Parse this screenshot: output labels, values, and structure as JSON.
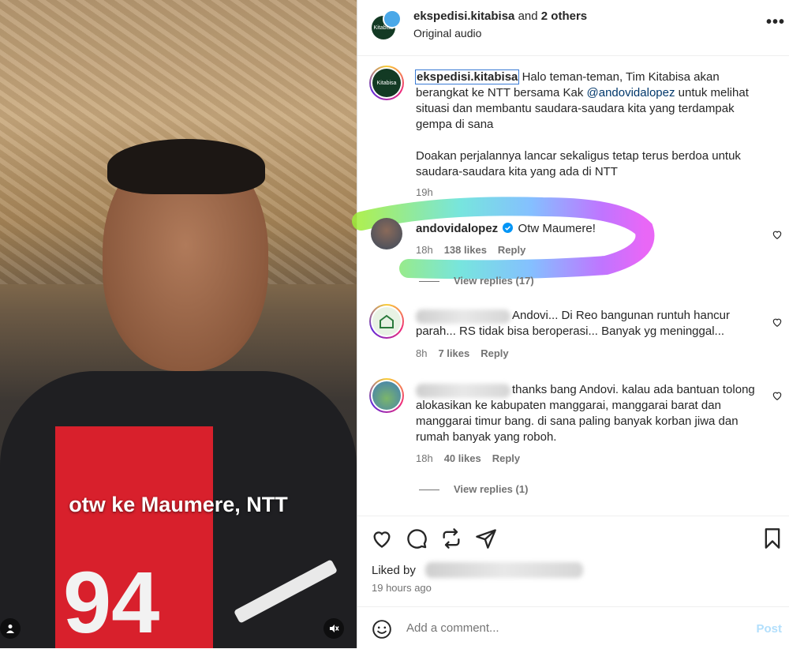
{
  "media": {
    "caption": "otw ke Maumere, NTT",
    "shirt_number": "94",
    "user_icon": "user-tag-icon",
    "mute_icon": "muted-speaker-icon"
  },
  "header": {
    "username": "ekspedisi.kitabisa",
    "and_text": "and",
    "others": "2 others",
    "subtitle": "Original audio",
    "avatar_label": "Kitabisa"
  },
  "post": {
    "username": "ekspedisi.kitabisa",
    "text_1": " Halo teman-teman, Tim Kitabisa akan berangkat ke NTT bersama Kak ",
    "mention": "@andovidalopez",
    "text_2": " untuk melihat situasi dan membantu saudara-saudara kita yang terdampak gempa di sana",
    "text_3": "Doakan perjalannya lancar sekaligus tetap terus berdoa untuk saudara-saudara kita yang ada di NTT",
    "time": "19h",
    "avatar_label": "Kitabisa"
  },
  "comments": [
    {
      "username": "andovidalopez",
      "verified": true,
      "text": "Otw Maumere!",
      "time": "18h",
      "likes": "138 likes",
      "reply": "Reply",
      "view_replies": "View replies (17)"
    },
    {
      "text": "Andovi... Di Reo bangunan runtuh hancur parah... RS tidak bisa beroperasi... Banyak yg meninggal...",
      "time": "8h",
      "likes": "7 likes",
      "reply": "Reply"
    },
    {
      "text": "thanks bang Andovi. kalau ada bantuan tolong alokasikan ke kabupaten manggarai, manggarai barat dan manggarai timur bang. di sana paling banyak korban jiwa dan rumah banyak yang roboh.",
      "time": "18h",
      "likes": "40 likes",
      "reply": "Reply",
      "view_replies": "View replies (1)"
    }
  ],
  "footer": {
    "liked_by": "Liked by",
    "time_ago": "19 hours ago",
    "comment_placeholder": "Add a comment...",
    "post_label": "Post"
  },
  "colors": {
    "mention": "#00376b",
    "verified": "#0095f6",
    "post_disabled": "#b2dffc",
    "secondary_text": "#737373"
  }
}
